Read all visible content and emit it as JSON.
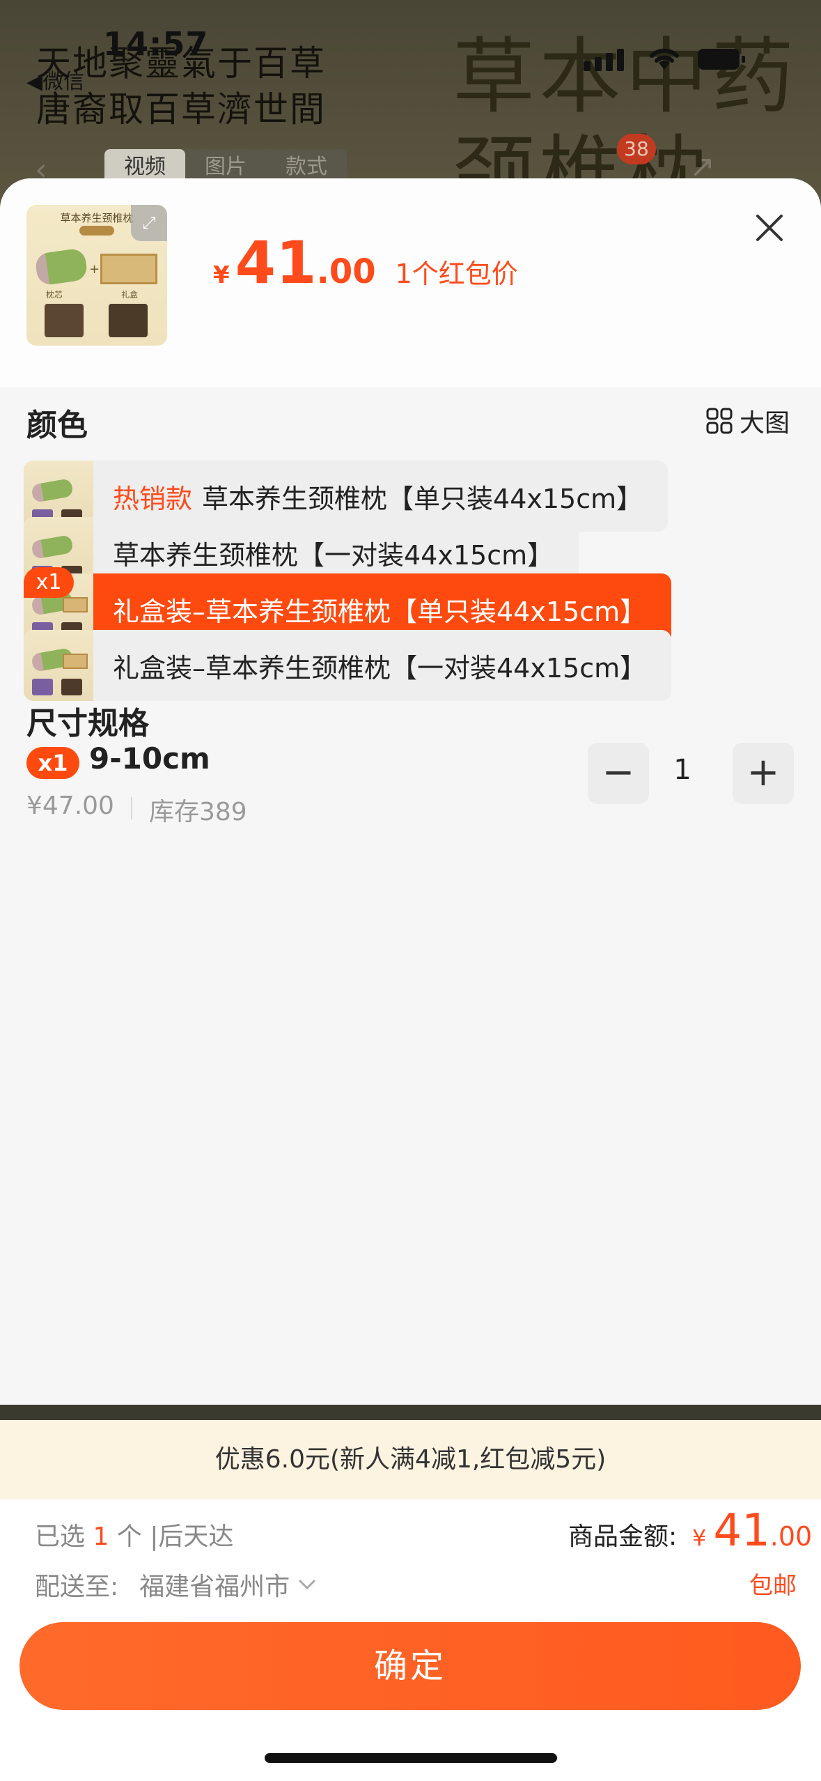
{
  "status_bar": {
    "time": "14:57",
    "back_app": "◀微信"
  },
  "background": {
    "poem_line1": "天地聚靈氣于百草",
    "poem_line2": "唐裔取百草濟世間",
    "big_title_line1": "草本中药",
    "big_title_line2": "颈椎枕",
    "tabs": [
      "视频",
      "图片",
      "款式"
    ],
    "active_tab": "视频",
    "cart_badge": "38"
  },
  "sheet": {
    "thumbnail": {
      "title": "草本养生颈椎枕",
      "label_left": "枕芯",
      "label_right": "礼盒"
    },
    "price": {
      "currency": "¥",
      "integer": "41",
      "decimal": ".00",
      "tag": "1个红包价"
    },
    "color_section": {
      "title": "颜色",
      "big_image_label": "大图",
      "options": [
        {
          "hot": "热销款",
          "label": "草本养生颈椎枕【单只装44x15cm】",
          "selected": false
        },
        {
          "hot": "",
          "label": "草本养生颈椎枕【一对装44x15cm】",
          "selected": false
        },
        {
          "hot": "",
          "label": "礼盒装–草本养生颈椎枕【单只装44x15cm】",
          "selected": true,
          "badge": "x1"
        },
        {
          "hot": "",
          "label": "礼盒装–草本养生颈椎枕【一对装44x15cm】",
          "selected": false
        }
      ]
    },
    "size_section": {
      "title": "尺寸规格",
      "item": {
        "badge": "x1",
        "name": "9-10cm",
        "price": "¥47.00",
        "stock": "库存389",
        "quantity": "1"
      }
    }
  },
  "promo": "优惠6.0元(新人满4减1,红包减5元)",
  "footer": {
    "selected_prefix": "已选",
    "selected_count": "1",
    "selected_suffix": "个 |后天达",
    "total_label": "商品金额:",
    "total_currency": "¥",
    "total_integer": "41",
    "total_decimal": ".00",
    "ship_label": "配送至:",
    "ship_location": "福建省福州市",
    "free_shipping": "包邮",
    "confirm_label": "确定"
  },
  "colors": {
    "accent": "#ff4a0f",
    "price": "#ff4b1c",
    "promo_bg": "#fdf3e1"
  }
}
